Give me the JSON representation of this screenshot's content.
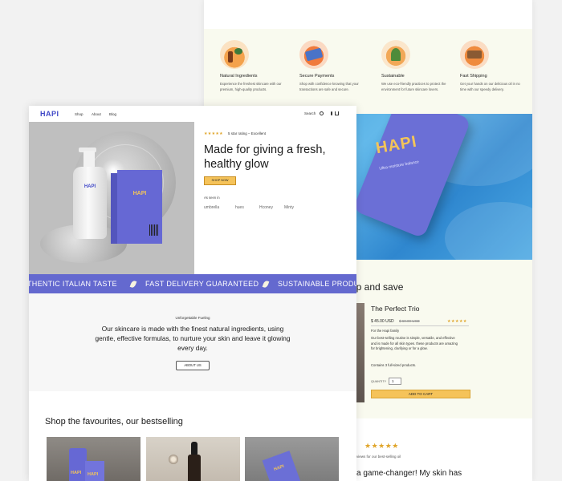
{
  "back_page": {
    "features": [
      {
        "icon": "natural-ingredients-icon",
        "title": "Natural Ingredients",
        "desc": "Experience the freshest skincare with our premium, high-quality products."
      },
      {
        "icon": "secure-payments-icon",
        "title": "Secure Payments",
        "desc": "Shop with confidence knowing that your transactions are safe and secure."
      },
      {
        "icon": "sustainable-icon",
        "title": "Sustainable",
        "desc": "We use eco-friendly practices to protect the environment for future skincare lovers."
      },
      {
        "icon": "fast-shipping-icon",
        "title": "Fast Shipping",
        "desc": "Get your hands on our delicious oil in no time with our speedy delivery."
      }
    ],
    "banner": {
      "logo": "HAPI",
      "text": "Ultra moisture balance"
    },
    "bundle": {
      "title": "up and save",
      "product_name": "The Perfect Trio",
      "stars": "★★★★★",
      "price": "$ 45.00 USD",
      "price_old": "$ 60.00 USD",
      "family": "For the Hapi family",
      "description": "Our best-selling routine is simple, versatile, and effective and is made for all skin types. these products are amazing for brightening, clarifying or for a glow.",
      "contains": "Contains 3 full-sized products.",
      "quantity_label": "QUANTITY",
      "quantity_value": "1",
      "add_to_cart": "ADD TO CART"
    },
    "review": {
      "stars": "★★★★★",
      "subtitle": "views for our best-selling oil",
      "quote": "a game-changer! My skin has"
    }
  },
  "front_page": {
    "nav": {
      "logo": "HAPI",
      "links": [
        "Shop",
        "About",
        "Blog"
      ],
      "search": "Search"
    },
    "hero": {
      "stars": "★★★★★",
      "rating": "5 star rating – Excellent",
      "title": "Made for giving a fresh, healthy glow",
      "cta": "SHOP NOW",
      "as_seen": "As seen in",
      "brands": [
        "umbrella",
        "hues",
        "Hconey",
        "Minty"
      ],
      "bottle_label": "HAPI",
      "box_label": "HAPI"
    },
    "marquee": {
      "items": [
        "THENTIC ITALIAN TASTE",
        "FAST DELIVERY GUARANTEED",
        "SUSTAINABLE PRODUC"
      ]
    },
    "about": {
      "kicker": "Unforgettable Fueling",
      "text": "Our skincare is made with the finest natural ingredients, using gentle, effective formulas, to nurture your skin and leave it glowing every day.",
      "button": "ABOUT US"
    },
    "bestsellers": {
      "title": "Shop the favourites, our bestselling",
      "card_logo": "HAPI"
    }
  },
  "colors": {
    "accent_blue": "#6469cf",
    "logo_blue": "#4048c7",
    "cta_yellow": "#f5c35a",
    "star_gold": "#e0a52a",
    "back_bg": "#f9faef"
  }
}
